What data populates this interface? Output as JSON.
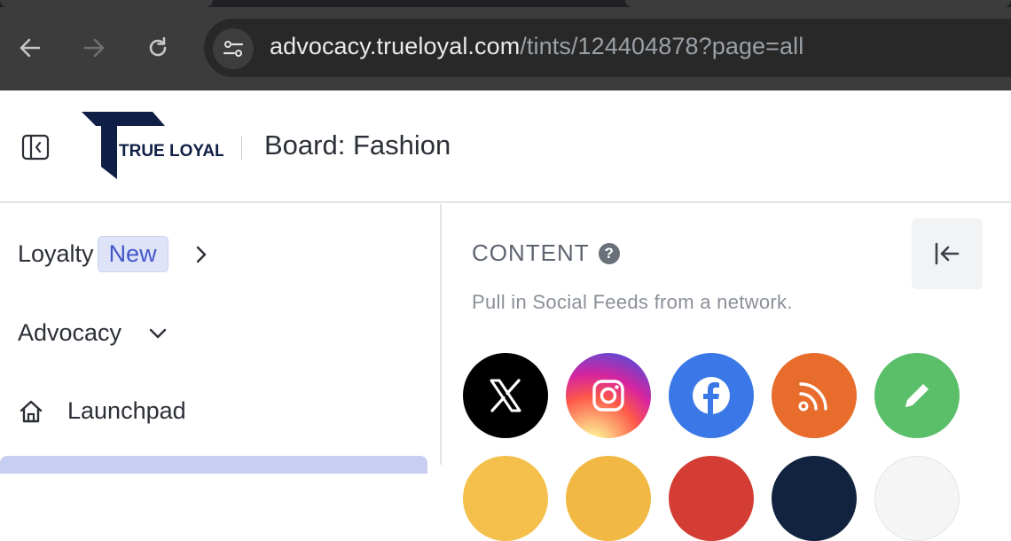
{
  "browser": {
    "url_host": "advocacy.trueloyal.com",
    "url_path": "/tints/124404878?page=all",
    "back_icon": "arrow-left-icon",
    "forward_icon": "arrow-right-icon",
    "reload_icon": "reload-icon",
    "site_info_icon": "tune-icon"
  },
  "header": {
    "logo_text": "TRUE LOYAL",
    "board_title": "Board: Fashion",
    "toggle_icon": "sidebar-collapse-icon"
  },
  "sidebar": {
    "loyalty_label": "Loyalty",
    "loyalty_badge": "New",
    "advocacy_label": "Advocacy",
    "launchpad_label": "Launchpad"
  },
  "content": {
    "heading": "CONTENT",
    "help_glyph": "?",
    "description": "Pull in Social Feeds from a network.",
    "networks": [
      "X",
      "Instagram",
      "Facebook",
      "RSS",
      "Custom Post"
    ]
  },
  "colors": {
    "browser_bg": "#3c3c3c",
    "logo_navy": "#0f1f45",
    "badge_bg": "#dfe3f8",
    "badge_text": "#4357c9",
    "active_item": "#c8cdf2",
    "x": "#000000",
    "facebook": "#3b78e7",
    "rss": "#e86c2c",
    "custom": "#5bbf6a"
  }
}
